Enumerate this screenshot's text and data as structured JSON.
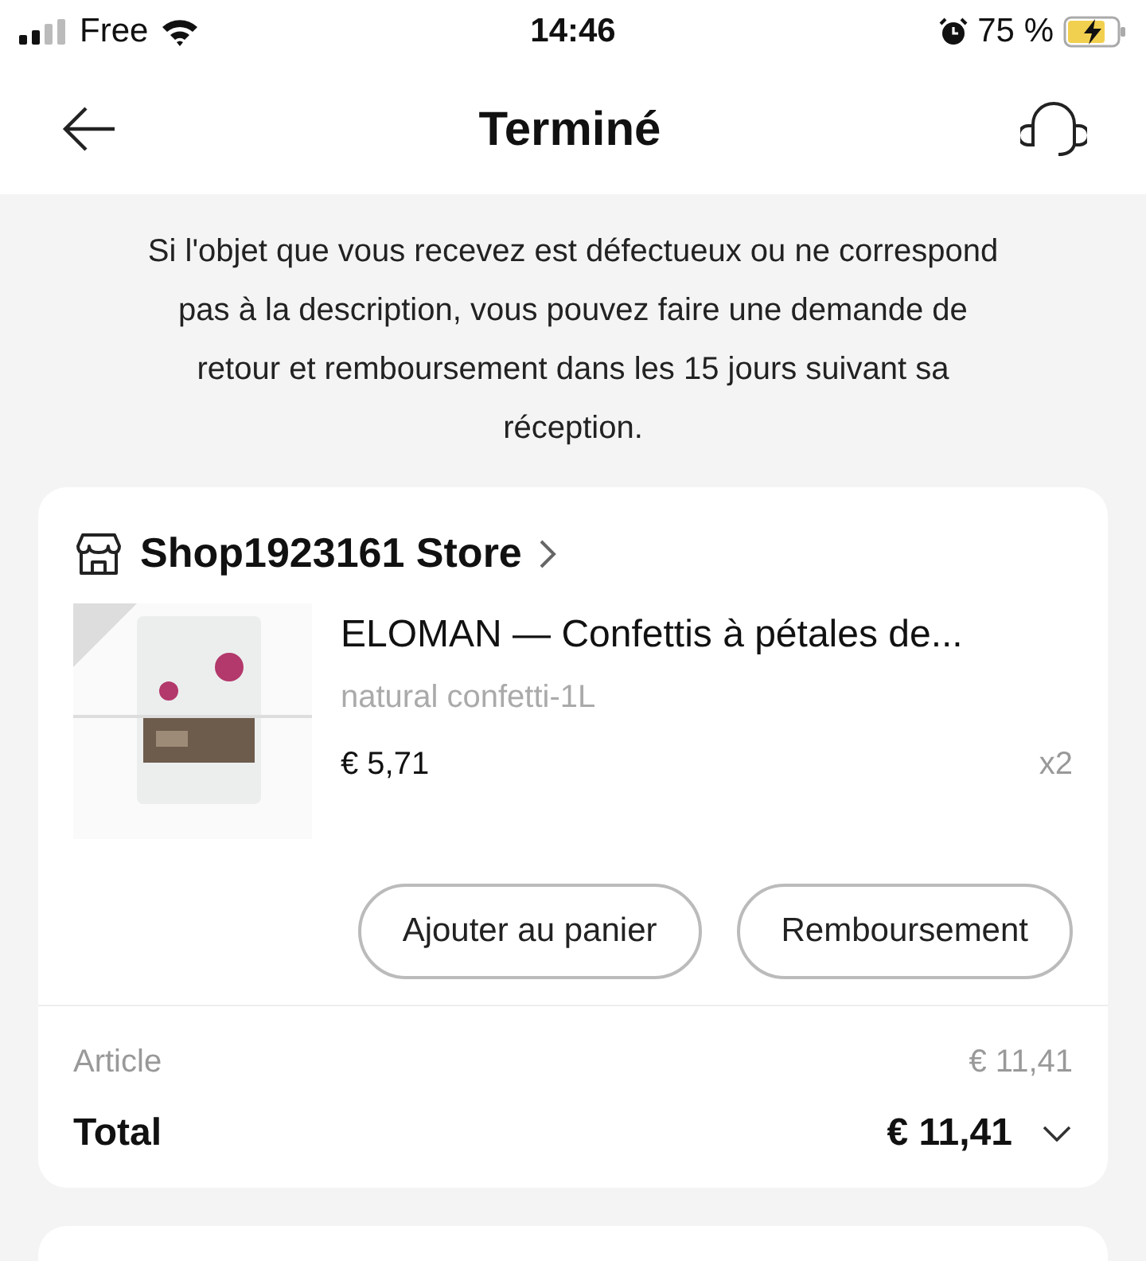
{
  "status_bar": {
    "carrier": "Free",
    "time": "14:46",
    "battery": "75 %",
    "charging": true
  },
  "header": {
    "title": "Terminé"
  },
  "notice": "Si l'objet que vous recevez est défectueux ou ne correspond pas à la description, vous pouvez faire une demande de retour et remboursement dans les 15 jours suivant sa réception.",
  "order": {
    "store": "Shop1923161 Store",
    "item": {
      "title": "ELOMAN — Confettis à pétales de...",
      "variant": "natural confetti-1L",
      "price": "€ 5,71",
      "quantity": "x2"
    },
    "buttons": [
      "Ajouter au panier",
      "Remboursement"
    ],
    "summary": [
      {
        "kind": "subtotal",
        "label": "Article",
        "value": "€ 11,41"
      },
      {
        "kind": "total",
        "label": "Total",
        "value": "€ 11,41",
        "expanded": false
      }
    ]
  }
}
